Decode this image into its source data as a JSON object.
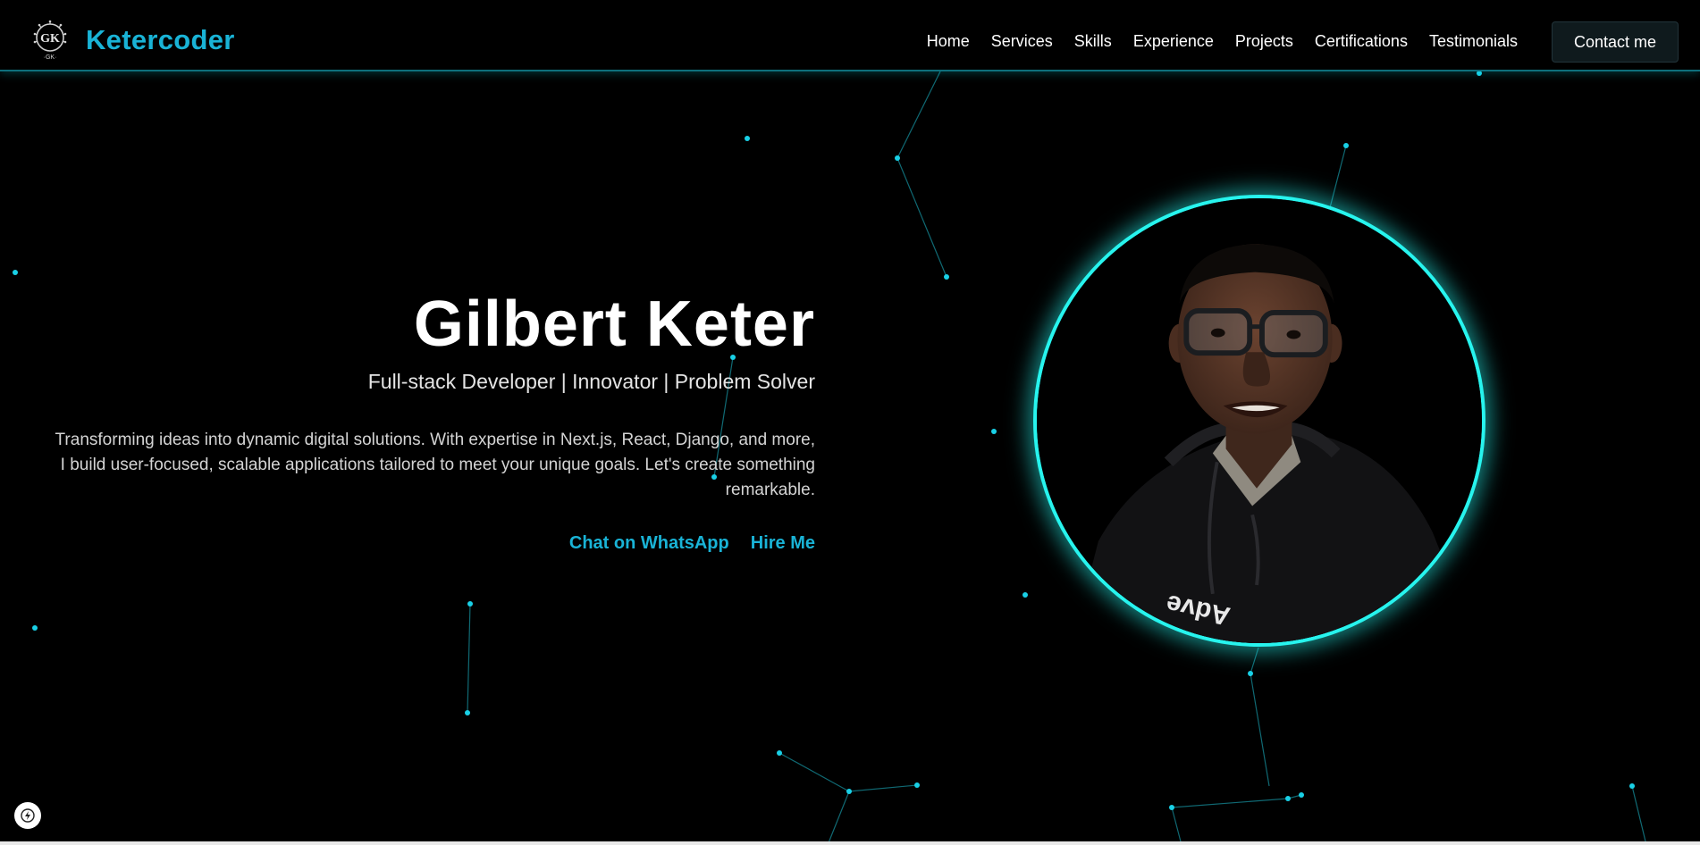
{
  "brand": {
    "logo_text": "GK",
    "logo_subtext": "·GK·",
    "name": "Ketercoder"
  },
  "nav": {
    "items": [
      "Home",
      "Services",
      "Skills",
      "Experience",
      "Projects",
      "Certifications",
      "Testimonials"
    ],
    "contact_label": "Contact me"
  },
  "hero": {
    "name": "Gilbert Keter",
    "tagline": "Full-stack Developer | Innovator | Problem Solver",
    "description": "Transforming ideas into dynamic digital solutions. With expertise in Next.js, React, Django, and more, I build user-focused, scalable applications tailored to meet your unique goals. Let's create something remarkable.",
    "whatsapp_label": "Chat on WhatsApp",
    "hire_label": "Hire Me"
  },
  "profile": {
    "shirt_text": "Adve"
  },
  "icons": {
    "logo": "gk-circuit-logo-icon",
    "dev_badge": "lightning-icon"
  },
  "colors": {
    "accent": "#19b3d6",
    "ring": "#27f4ee",
    "particle": "#19d0e6",
    "background": "#000000"
  }
}
